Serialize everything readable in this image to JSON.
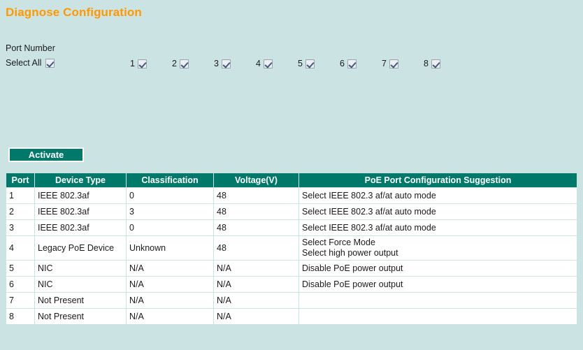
{
  "page": {
    "title": "Diagnose Configuration",
    "accent_title_color": "#ff9900",
    "background_color": "#cce3e3",
    "table_header_color": "#00786a"
  },
  "port_selector": {
    "group_label": "Port Number",
    "select_all_label": "Select All",
    "select_all_checked": true,
    "ports": [
      {
        "label": "1",
        "checked": true
      },
      {
        "label": "2",
        "checked": true
      },
      {
        "label": "3",
        "checked": true
      },
      {
        "label": "4",
        "checked": true
      },
      {
        "label": "5",
        "checked": true
      },
      {
        "label": "6",
        "checked": true
      },
      {
        "label": "7",
        "checked": true
      },
      {
        "label": "8",
        "checked": true
      }
    ]
  },
  "actions": {
    "activate_label": "Activate"
  },
  "table": {
    "columns": [
      "Port",
      "Device Type",
      "Classification",
      "Voltage(V)",
      "PoE Port Configuration Suggestion"
    ],
    "rows": [
      {
        "port": "1",
        "device_type": "IEEE 802.3af",
        "classification": "0",
        "voltage": "48",
        "suggestion_line1": "Select IEEE 802.3 af/at auto mode",
        "suggestion_line2": ""
      },
      {
        "port": "2",
        "device_type": "IEEE 802.3af",
        "classification": "3",
        "voltage": "48",
        "suggestion_line1": "Select IEEE 802.3 af/at auto mode",
        "suggestion_line2": ""
      },
      {
        "port": "3",
        "device_type": "IEEE 802.3af",
        "classification": "0",
        "voltage": "48",
        "suggestion_line1": "Select IEEE 802.3 af/at auto mode",
        "suggestion_line2": ""
      },
      {
        "port": "4",
        "device_type": "Legacy PoE Device",
        "classification": "Unknown",
        "voltage": "48",
        "suggestion_line1": "Select Force Mode",
        "suggestion_line2": "Select high power output"
      },
      {
        "port": "5",
        "device_type": "NIC",
        "classification": "N/A",
        "voltage": "N/A",
        "suggestion_line1": "Disable PoE power output",
        "suggestion_line2": ""
      },
      {
        "port": "6",
        "device_type": "NIC",
        "classification": "N/A",
        "voltage": "N/A",
        "suggestion_line1": "Disable PoE power output",
        "suggestion_line2": ""
      },
      {
        "port": "7",
        "device_type": "Not Present",
        "classification": "N/A",
        "voltage": "N/A",
        "suggestion_line1": "",
        "suggestion_line2": ""
      },
      {
        "port": "8",
        "device_type": "Not Present",
        "classification": "N/A",
        "voltage": "N/A",
        "suggestion_line1": "",
        "suggestion_line2": ""
      }
    ]
  }
}
